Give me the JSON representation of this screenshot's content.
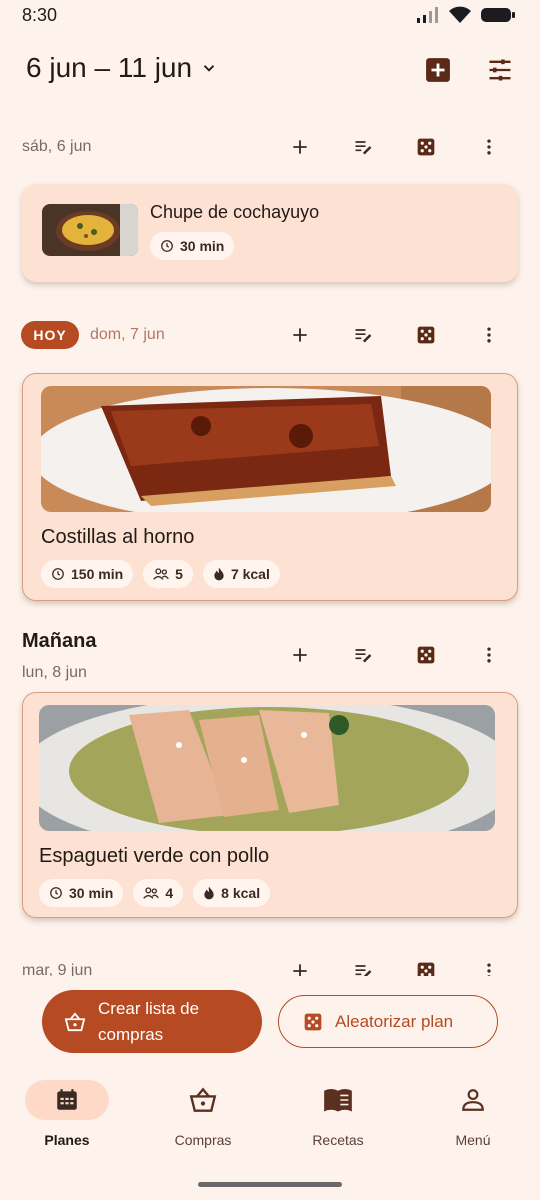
{
  "status": {
    "time": "8:30"
  },
  "header": {
    "range": "6 jun – 11 jun"
  },
  "days": [
    {
      "label": "sáb, 6 jun"
    },
    {
      "badge": "HOY",
      "label": "dom, 7 jun"
    },
    {
      "heading": "Mañana",
      "label": "lun, 8 jun"
    },
    {
      "label": "mar, 9 jun"
    }
  ],
  "meals": [
    {
      "title": "Chupe de cochayuyo",
      "time": "30 min"
    },
    {
      "title": "Costillas al horno",
      "time": "150 min",
      "servings": "5",
      "kcal": "7 kcal"
    },
    {
      "title": "Espagueti verde con pollo",
      "time": "30 min",
      "servings": "4",
      "kcal": "8 kcal"
    }
  ],
  "actions": {
    "shopping_list": "Crear lista de compras",
    "randomize": "Aleatorizar plan"
  },
  "nav": [
    {
      "label": "Planes",
      "icon": "calendar-icon",
      "active": true
    },
    {
      "label": "Compras",
      "icon": "basket-icon"
    },
    {
      "label": "Recetas",
      "icon": "book-icon"
    },
    {
      "label": "Menú",
      "icon": "person-icon"
    }
  ],
  "colors": {
    "primary": "#b64a22",
    "background": "#fdf3ec",
    "card": "#fde2d3"
  }
}
